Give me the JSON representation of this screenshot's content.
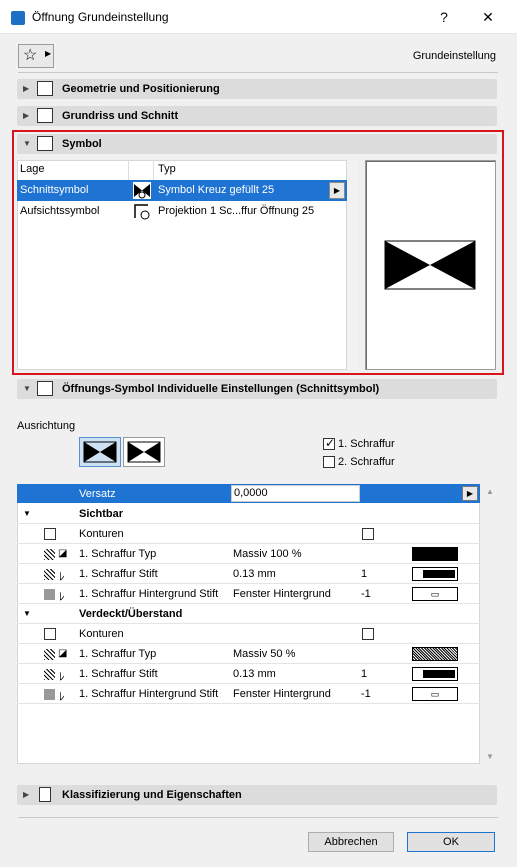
{
  "window": {
    "title": "Öffnung Grundeinstellung",
    "help": "?",
    "close": "✕"
  },
  "preset_label": "Grundeinstellung",
  "panels": {
    "geometrie": "Geometrie und Positionierung",
    "grundriss": "Grundriss und Schnitt",
    "symbol": "Symbol",
    "individuell": "Öffnungs-Symbol Individuelle Einstellungen (Schnittsymbol)",
    "klassifizierung": "Klassifizierung und Eigenschaften"
  },
  "symbol_table": {
    "headers": [
      "Lage",
      "Typ"
    ],
    "rows": [
      {
        "lage": "Schnittsymbol",
        "typ": "Symbol Kreuz gefüllt 25",
        "selected": true
      },
      {
        "lage": "Aufsichtssymbol",
        "typ": "Projektion 1 Sc...ffur Öffnung 25",
        "selected": false
      }
    ]
  },
  "ausrichtung": {
    "label": "Ausrichtung"
  },
  "schraffur_checks": [
    {
      "label": "1. Schraffur",
      "checked": true
    },
    {
      "label": "2. Schraffur",
      "checked": false
    }
  ],
  "settings": {
    "versatz": {
      "label": "Versatz",
      "value": "0,0000"
    },
    "sichtbar": {
      "heading": "Sichtbar",
      "konturen": "Konturen",
      "rows": [
        {
          "label": "1. Schraffur Typ",
          "value": "Massiv 100 %",
          "extra": ""
        },
        {
          "label": "1. Schraffur Stift",
          "value": "0.13 mm",
          "extra": "1"
        },
        {
          "label": "1. Schraffur Hintergrund Stift",
          "value": "Fenster Hintergrund",
          "extra": "-1"
        }
      ]
    },
    "verdeckt": {
      "heading": "Verdeckt/Überstand",
      "konturen": "Konturen",
      "rows": [
        {
          "label": "1. Schraffur Typ",
          "value": "Massiv 50 %",
          "extra": ""
        },
        {
          "label": "1. Schraffur Stift",
          "value": "0.13 mm",
          "extra": "1"
        },
        {
          "label": "1. Schraffur Hintergrund Stift",
          "value": "Fenster Hintergrund",
          "extra": "-1"
        }
      ]
    }
  },
  "buttons": {
    "cancel": "Abbrechen",
    "ok": "OK"
  },
  "colors": {
    "accent": "#1f73d2",
    "highlight": "#d8151d"
  }
}
